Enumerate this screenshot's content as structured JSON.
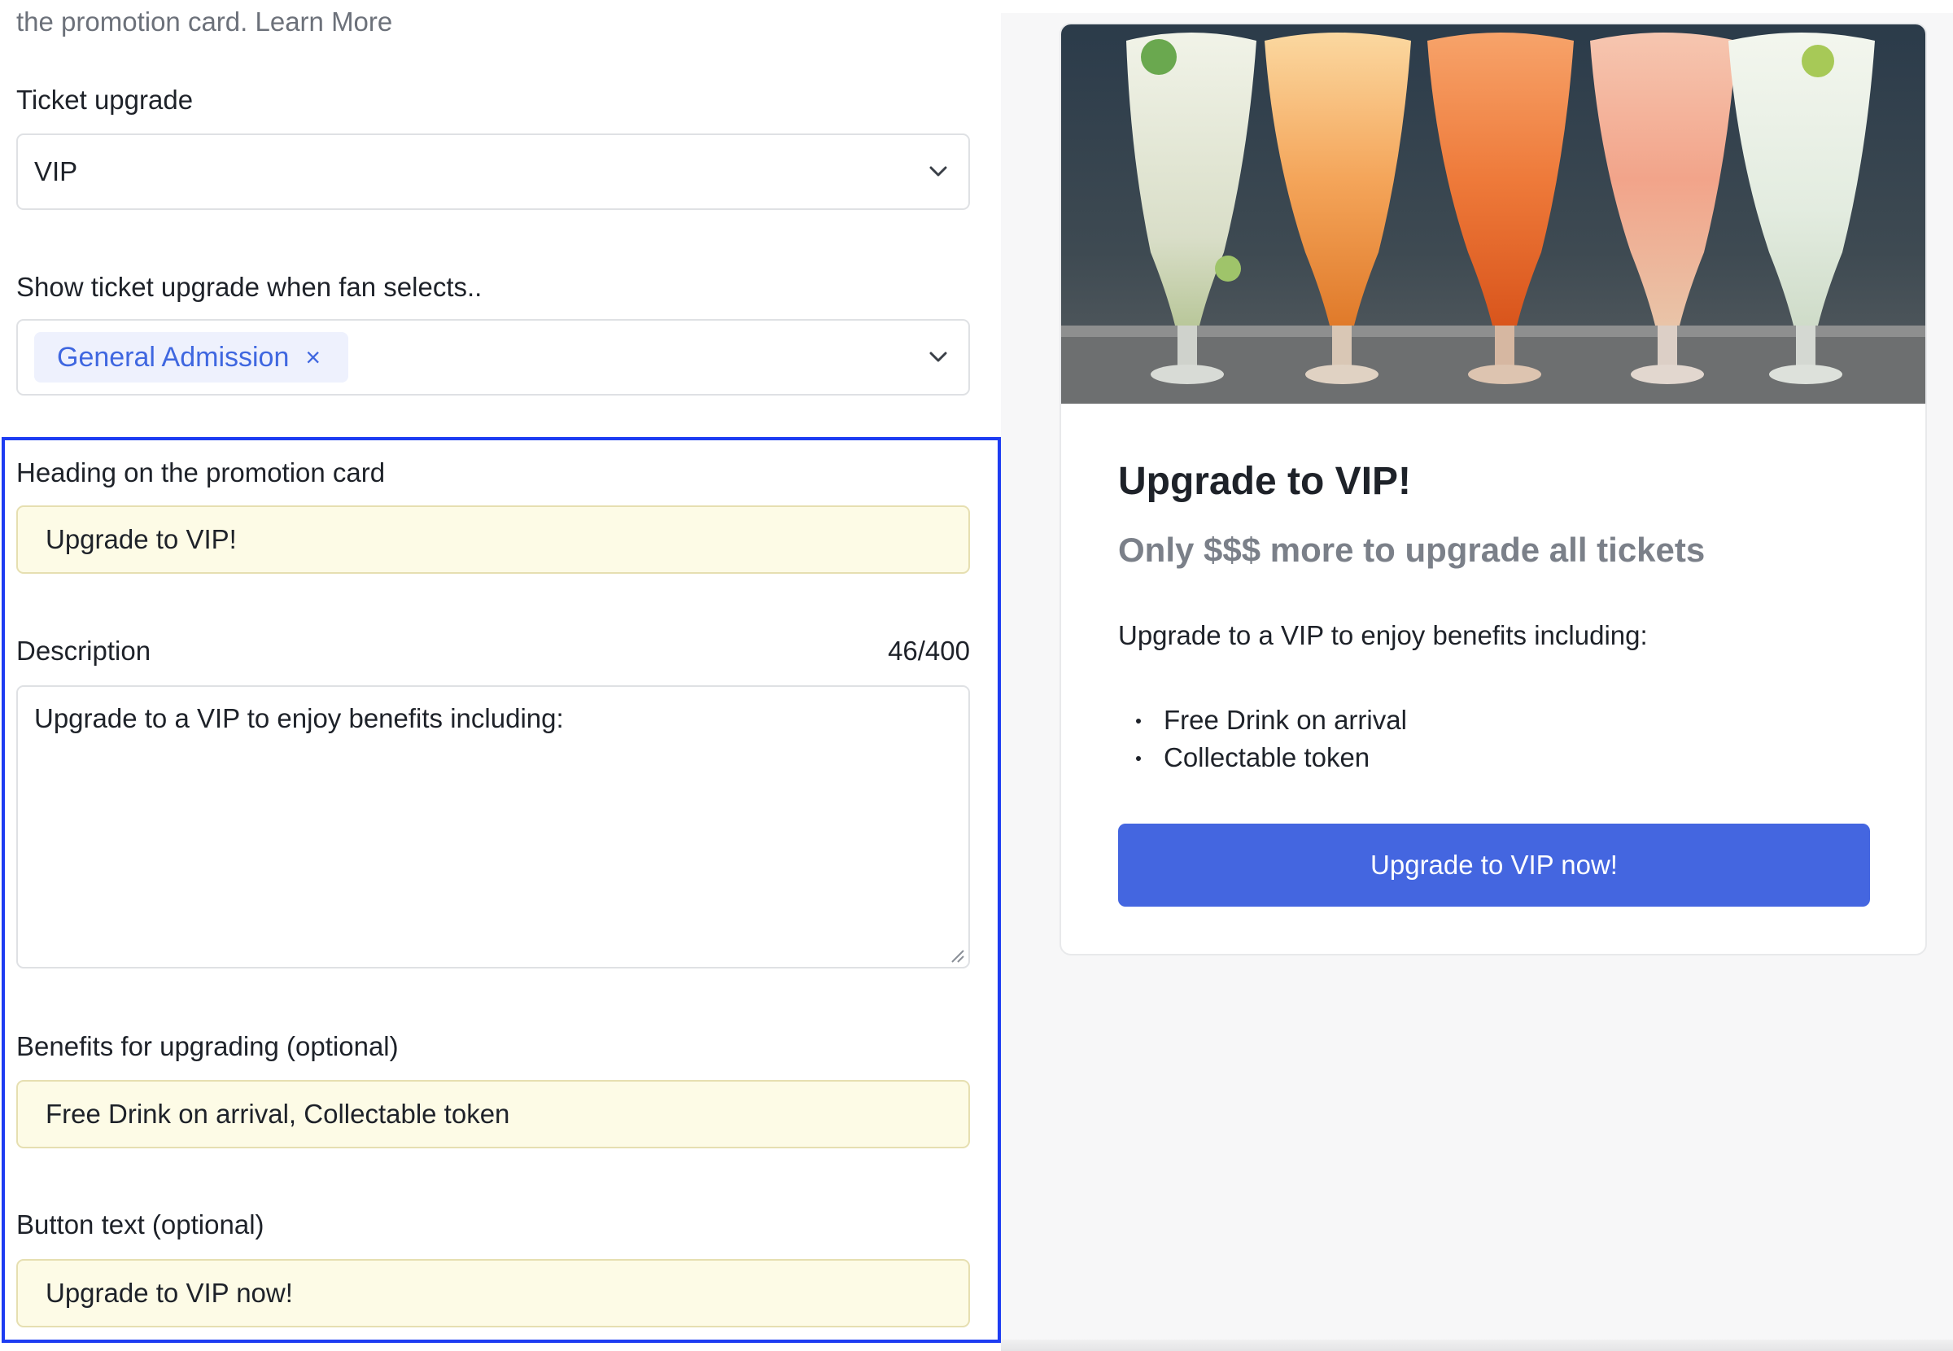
{
  "form": {
    "intro_text": "the promotion card.",
    "learn_more": "Learn More",
    "ticket_upgrade": {
      "label": "Ticket upgrade",
      "value": "VIP"
    },
    "show_when": {
      "label": "Show ticket upgrade when fan selects..",
      "chip": "General Admission",
      "chip_remove": "×"
    },
    "heading": {
      "label": "Heading on the promotion card",
      "value": "Upgrade to VIP!"
    },
    "description": {
      "label": "Description",
      "counter": "46/400",
      "value": "Upgrade to a VIP to enjoy benefits including:"
    },
    "benefits": {
      "label": "Benefits for upgrading (optional)",
      "value": "Free Drink on arrival, Collectable token"
    },
    "button_text": {
      "label": "Button text (optional)",
      "value": "Upgrade to VIP now!"
    }
  },
  "preview": {
    "image_icon": "cocktail-glasses-photo",
    "title": "Upgrade to VIP!",
    "subtitle": "Only $$$ more to upgrade all tickets",
    "description": "Upgrade to a VIP to enjoy benefits including:",
    "benefits": [
      "Free Drink on arrival",
      "Collectable token"
    ],
    "button": "Upgrade to VIP now!"
  },
  "colors": {
    "accent": "#4466e0",
    "chip_text": "#3f67e0",
    "chip_bg": "#eef1fd",
    "highlight_border": "#1d3cf2",
    "autofill_bg": "#fdfbe6"
  }
}
